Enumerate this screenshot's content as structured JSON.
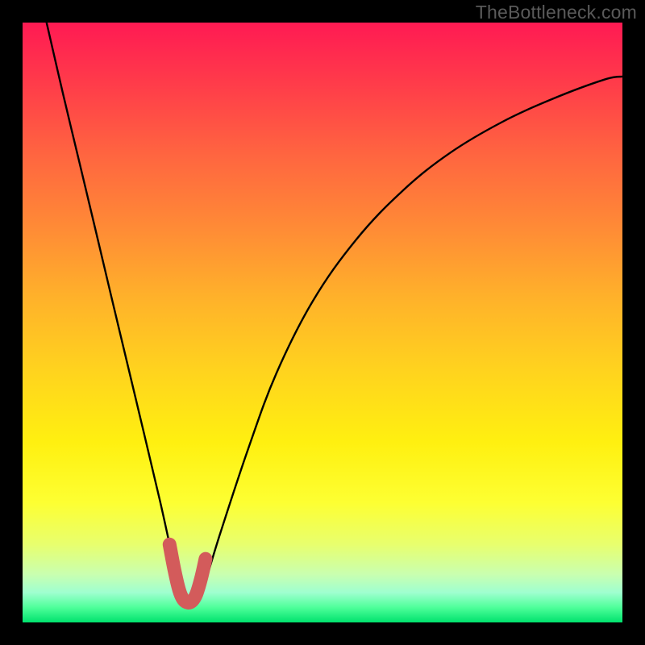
{
  "watermark": "TheBottleneck.com",
  "chart_data": {
    "type": "line",
    "title": "",
    "xlabel": "",
    "ylabel": "",
    "xlim": [
      0,
      100
    ],
    "ylim": [
      0,
      100
    ],
    "series": [
      {
        "name": "bottleneck-curve",
        "color": "#000000",
        "x": [
          4.0,
          6.7,
          9.4,
          12.1,
          14.8,
          17.5,
          20.2,
          22.9,
          24.7,
          26.1,
          27.4,
          28.8,
          30.1,
          33.0,
          37.6,
          42.3,
          48.4,
          55.6,
          63.4,
          71.3,
          79.9,
          88.4,
          97.0,
          100.0
        ],
        "y": [
          100.0,
          88.3,
          77.0,
          65.7,
          54.3,
          43.0,
          31.7,
          20.3,
          12.2,
          6.5,
          3.5,
          3.3,
          5.7,
          15.0,
          28.9,
          41.5,
          53.6,
          63.8,
          72.0,
          78.3,
          83.4,
          87.3,
          90.5,
          91.0
        ]
      },
      {
        "name": "highlight-valley",
        "color": "#d35b5b",
        "x": [
          24.5,
          25.3,
          26.1,
          26.8,
          27.6,
          28.3,
          29.0,
          29.8,
          30.5
        ],
        "y": [
          13.0,
          8.8,
          5.4,
          3.8,
          3.3,
          3.6,
          4.8,
          7.5,
          10.6
        ]
      }
    ]
  }
}
